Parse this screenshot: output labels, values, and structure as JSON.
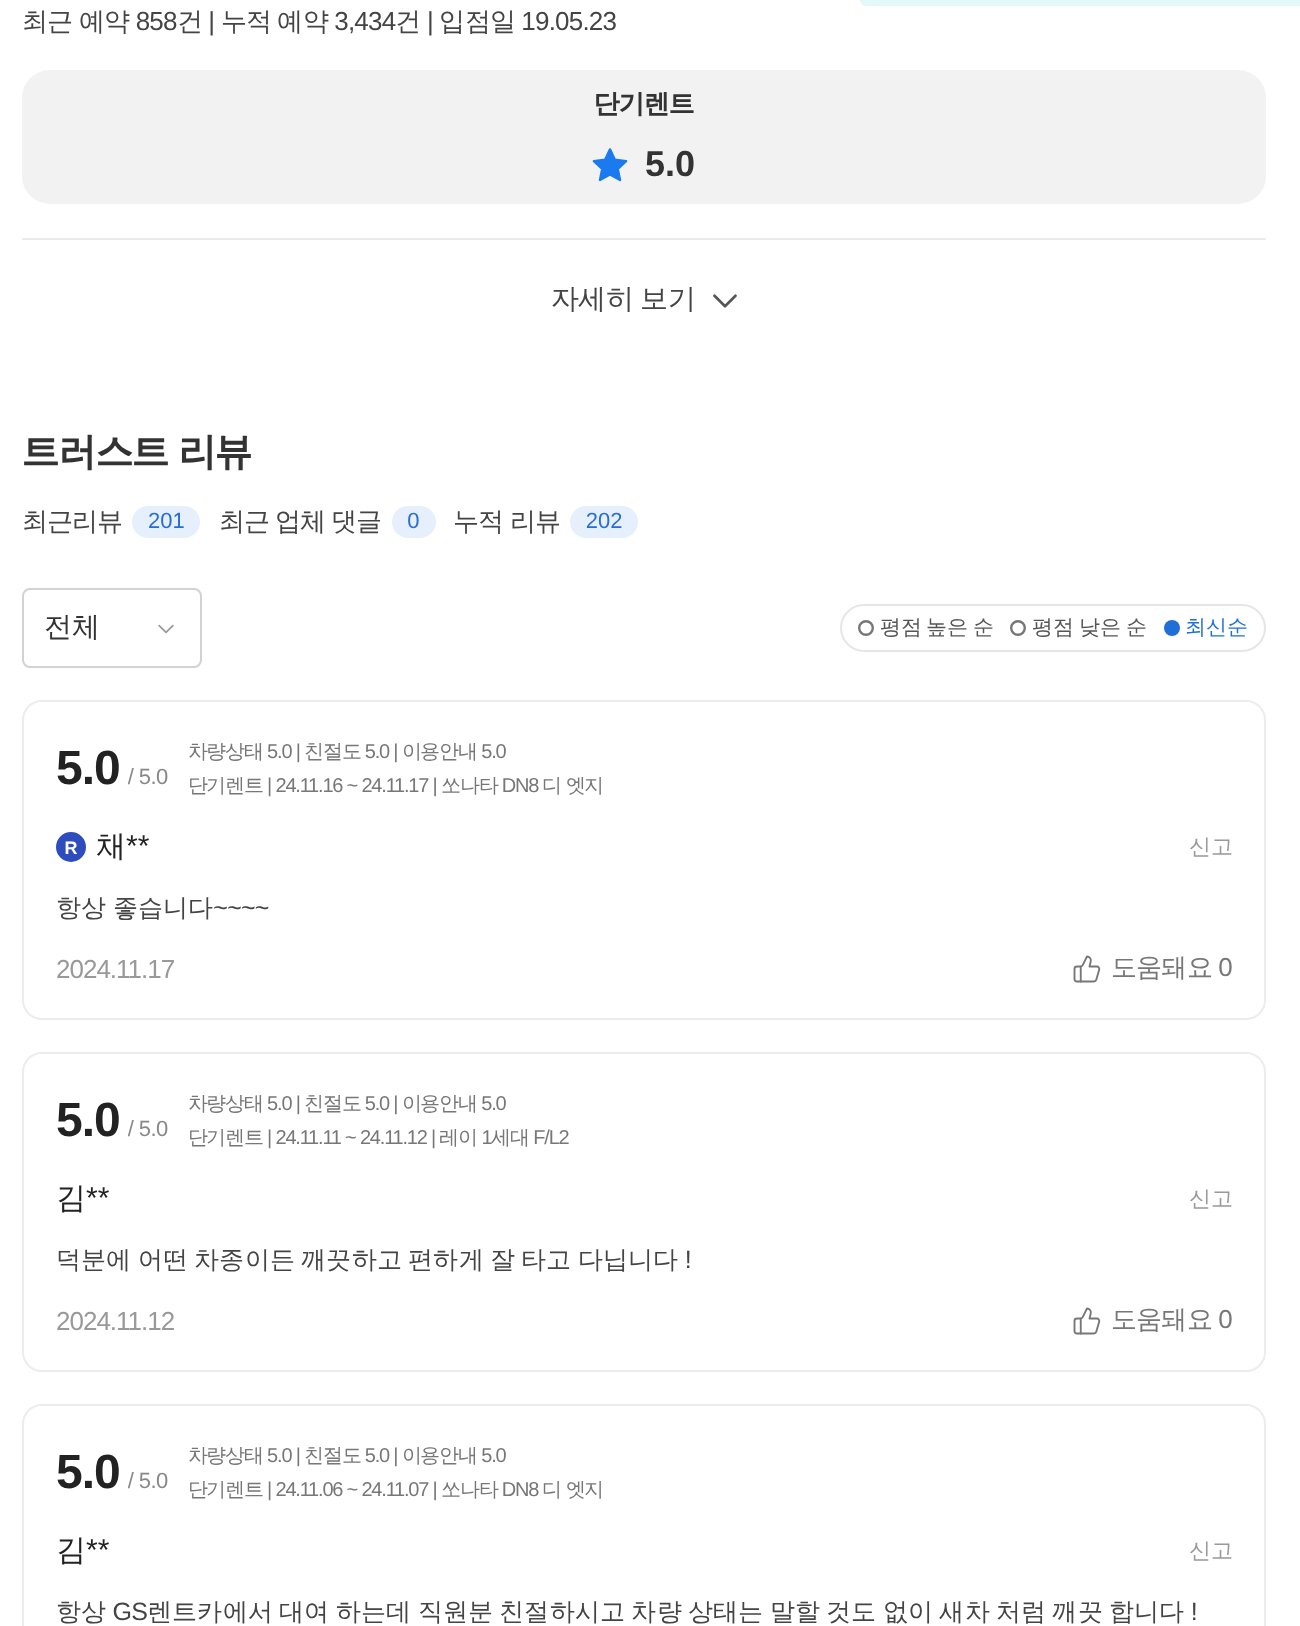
{
  "header": {
    "stats": "최근 예약 858건 | 누적 예약 3,434건 | 입점일 19.05.23"
  },
  "rating_card": {
    "title": "단기렌트",
    "score": "5.0"
  },
  "more_button": {
    "label": "자세히 보기",
    "expanded": false
  },
  "reviews_section": {
    "title": "트러스트 리뷰",
    "counts": [
      {
        "label": "최근리뷰",
        "count": "201"
      },
      {
        "label": "최근 업체 댓글",
        "count": "0"
      },
      {
        "label": "누적 리뷰",
        "count": "202"
      }
    ]
  },
  "filter": {
    "value": "전체"
  },
  "sort_options": [
    {
      "label": "평점 높은 순",
      "selected": false
    },
    {
      "label": "평점 낮은 순",
      "selected": false
    },
    {
      "label": "최신순",
      "selected": true
    }
  ],
  "reviews": [
    {
      "score": "5.0",
      "max": "/ 5.0",
      "ratings": "차량상태 5.0 | 친절도 5.0 | 이용안내 5.0",
      "details": "단기렌트 | 24.11.16 ~ 24.11.17 | 쏘나타 DN8 디 엣지",
      "badge": "R",
      "author": "채**",
      "report": "신고",
      "body": "항상 좋습니다~~~~",
      "date": "2024.11.17",
      "helpful": "도움돼요 0"
    },
    {
      "score": "5.0",
      "max": "/ 5.0",
      "ratings": "차량상태 5.0 | 친절도 5.0 | 이용안내 5.0",
      "details": "단기렌트 | 24.11.11 ~ 24.11.12 | 레이 1세대 F/L2",
      "author": "김**",
      "report": "신고",
      "body": "덕분에 어떤 차종이든 깨끗하고 편하게 잘 타고 다닙니다 !",
      "date": "2024.11.12",
      "helpful": "도움돼요 0"
    },
    {
      "score": "5.0",
      "max": "/ 5.0",
      "ratings": "차량상태 5.0 | 친절도 5.0 | 이용안내 5.0",
      "details": "단기렌트 | 24.11.06 ~ 24.11.07 | 쏘나타 DN8 디 엣지",
      "author": "김**",
      "report": "신고",
      "body": "항상 GS렌트카에서 대여 하는데 직원분 친절하시고 차량 상태는 말할 것도 없이 새차 처럼 깨끗 합니다 !"
    }
  ]
}
